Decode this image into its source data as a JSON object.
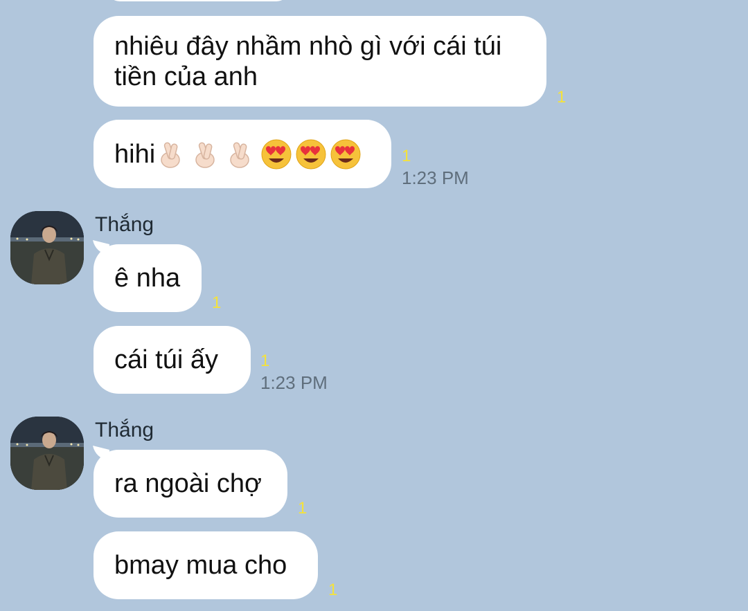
{
  "messages": {
    "m1": {
      "text": "nhiêu đây nhầm nhò gì với cái túi tiền của anh",
      "read": "1"
    },
    "m2": {
      "text": "hihi",
      "read": "1",
      "time": "1:23 PM",
      "emoji_icons": [
        "crossed-fingers-icon",
        "crossed-fingers-icon",
        "crossed-fingers-icon",
        "heart-eyes-icon",
        "heart-eyes-icon",
        "heart-eyes-icon"
      ]
    },
    "m3": {
      "sender": "Thắng",
      "text": "ê nha",
      "read": "1"
    },
    "m4": {
      "text": "cái túi ấy",
      "read": "1",
      "time": "1:23 PM"
    },
    "m5": {
      "sender": "Thắng",
      "text": "ra ngoài chợ",
      "read": "1"
    },
    "m6": {
      "text": "bmay mua cho",
      "read": "1"
    }
  },
  "colors": {
    "background": "#b1c6dc",
    "bubble": "#ffffff",
    "read_indicator": "#f5e23a",
    "timestamp": "#5f6e7c"
  }
}
